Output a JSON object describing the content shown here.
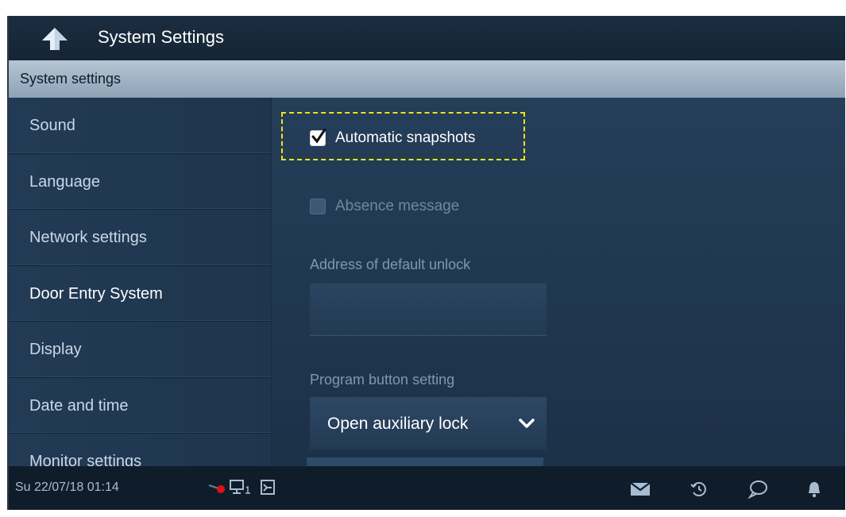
{
  "header": {
    "title": "System Settings"
  },
  "section": {
    "title": "System settings"
  },
  "sidebar": {
    "items": [
      {
        "label": "Sound"
      },
      {
        "label": "Language"
      },
      {
        "label": "Network settings"
      },
      {
        "label": "Door Entry System"
      },
      {
        "label": "Display"
      },
      {
        "label": "Date and time"
      },
      {
        "label": "Monitor settings"
      }
    ],
    "active": "Door Entry System"
  },
  "main": {
    "automatic_snapshots": {
      "label": "Automatic snapshots",
      "checked": true
    },
    "absence_message": {
      "label": "Absence message",
      "checked": false
    },
    "default_unlock": {
      "label": "Address of default unlock",
      "value": ""
    },
    "program_button": {
      "label": "Program button setting",
      "selected": "Open auxiliary lock"
    }
  },
  "statusbar": {
    "datetime": "Su 22/07/18  01:14",
    "icons": [
      "record-indicator-icon",
      "monitor-icon",
      "door-icon",
      "mail-icon",
      "history-icon",
      "chat-icon",
      "bell-icon"
    ]
  },
  "colors": {
    "accent_yellow": "#f0e21a",
    "record_red": "#e0101a"
  }
}
